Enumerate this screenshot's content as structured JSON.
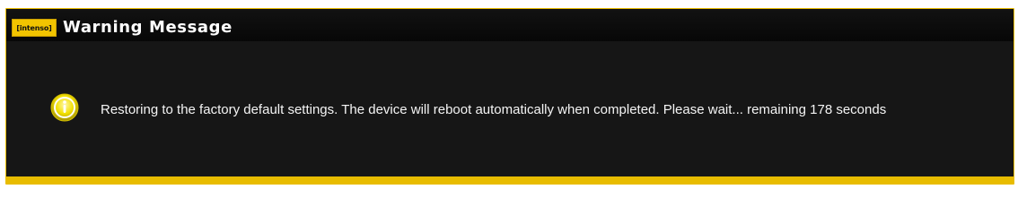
{
  "window": {
    "title": "Warning Message",
    "logo_text": "[intenso]"
  },
  "message": {
    "text": "Restoring to the factory default settings. The device will reboot automatically when completed. Please wait... remaining 178 seconds"
  },
  "icon": {
    "name": "info-icon"
  },
  "colors": {
    "accent": "#e8bc00",
    "background": "#161616",
    "title_bar": "#0b0b0b",
    "text": "#f4f4f4"
  }
}
